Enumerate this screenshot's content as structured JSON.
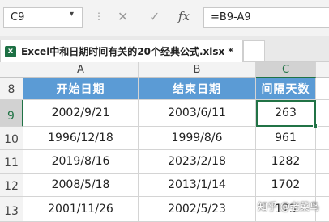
{
  "formula_bar": {
    "name_box": "C9",
    "formula": "=B9-A9",
    "cancel_glyph": "✕",
    "enter_glyph": "✓",
    "fx_label": "fx",
    "separator_glyph": "⋮"
  },
  "workbook": {
    "file_tab_label": "Excel中和日期时间有关的20个经典公式.xlsx *",
    "icon_letter": "x"
  },
  "columns": [
    "A",
    "B",
    "C"
  ],
  "selected_column": "C",
  "rows": [
    {
      "num": "8",
      "cells": [
        "开始日期",
        "结束日期",
        "间隔天数"
      ]
    },
    {
      "num": "9",
      "cells": [
        "2002/9/21",
        "2003/6/11",
        "263"
      ]
    },
    {
      "num": "10",
      "cells": [
        "1996/12/18",
        "1999/8/6",
        "961"
      ]
    },
    {
      "num": "11",
      "cells": [
        "2019/8/16",
        "2023/2/18",
        "1282"
      ]
    },
    {
      "num": "12",
      "cells": [
        "2008/5/18",
        "2013/1/14",
        "1702"
      ]
    },
    {
      "num": "13",
      "cells": [
        "2001/11/26",
        "2002/5/23",
        "173"
      ]
    }
  ],
  "selected_row": "9",
  "header_fill": "#5b9bd5",
  "accent": "#217346",
  "watermark": "知乎 @老菜鸟"
}
